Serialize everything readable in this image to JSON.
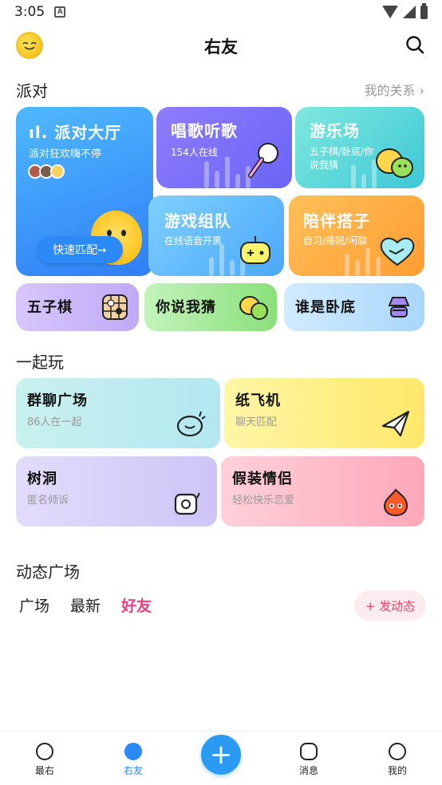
{
  "status": {
    "time": "3:05",
    "sim": "A"
  },
  "header": {
    "title": "右友"
  },
  "party": {
    "title": "派对",
    "relations": "我的关系 ›",
    "hall": {
      "title": "ıl. 派对大厅",
      "subtitle": "派对狂欢嗨不停",
      "match": "快速匹配➙"
    },
    "sing": {
      "title": "唱歌听歌",
      "subtitle": "154人在线"
    },
    "fun": {
      "title": "游乐场",
      "subtitle": "五子棋/卧底/你说我猜"
    },
    "game": {
      "title": "游戏组队",
      "subtitle": "在线语音开黑"
    },
    "companion": {
      "title": "陪伴搭子",
      "subtitle": "自习/睡眠/闲聊"
    },
    "small": [
      {
        "title": "五子棋"
      },
      {
        "title": "你说我猜"
      },
      {
        "title": "谁是卧底"
      }
    ]
  },
  "play": {
    "title": "一起玩",
    "items": [
      {
        "title": "群聊广场",
        "subtitle": "86人在一起"
      },
      {
        "title": "纸飞机",
        "subtitle": "聊天匹配"
      },
      {
        "title": "树洞",
        "subtitle": "匿名倾诉"
      },
      {
        "title": "假装情侣",
        "subtitle": "轻松快乐恋爱"
      }
    ]
  },
  "feed": {
    "title": "动态广场",
    "tabs": [
      "广场",
      "最新",
      "好友"
    ],
    "post": "+ 发动态"
  },
  "nav": {
    "items": [
      "最右",
      "右友",
      "消息",
      "我的"
    ],
    "plus": "+"
  }
}
